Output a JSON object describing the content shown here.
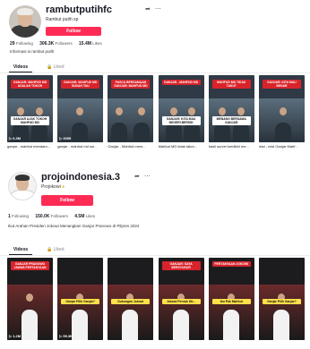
{
  "profiles": [
    {
      "username": "rambutputihfc",
      "nickname": "Rambut putih xp",
      "follow_label": "Follow",
      "stats": {
        "following": "29",
        "following_label": "Following",
        "followers": "306.3K",
        "followers_label": "Followers",
        "likes": "15.4M",
        "likes_label": "Likes"
      },
      "bio": "Informasi si rambut putih",
      "tabs": {
        "videos": "Videos",
        "liked": "Liked"
      },
      "videos": [
        {
          "caption_top": "GANJAR: MAHFUD MD ADALAH TOKOH",
          "caption_mid": "GANJAR AJAK TOKOH MAHFUD MD",
          "views": "6.3M",
          "title": "ganjar - mahfud mendam..."
        },
        {
          "caption_top": "GANJAR: MAHFUD MD SUDAH TAU",
          "caption_mid": "",
          "views": "3095",
          "title": "ganjar - mahfud md sul..."
        },
        {
          "caption_top": "PASCA BERSAMAAN GANJAR: MAHFUD MD",
          "caption_mid": "",
          "views": "",
          "title": "Ganjar - Mahfud mem..."
        },
        {
          "caption_top": "GANJAR - MAHFUD MD",
          "caption_mid": "GANJAR: KITA MAU NEGERI BERSIH",
          "views": "",
          "title": "Mahfud MD tidak takut..."
        },
        {
          "caption_top": "MAHFUD MD TIDAK TAKUT",
          "caption_mid": "MENANG BERSAMA GANJAR",
          "views": "",
          "title": "hasil survei kredibel me..."
        },
        {
          "caption_top": "GANJAR: KITA MAU BENAR",
          "caption_mid": "",
          "views": "",
          "title": "wisi - misi Ganjar Mahf..."
        }
      ]
    },
    {
      "username": "projoindonesia.3",
      "nickname": "Projokowi",
      "follow_label": "Follow",
      "stats": {
        "following": "1",
        "following_label": "Following",
        "followers": "150.0K",
        "followers_label": "Followers",
        "likes": "4.5M",
        "likes_label": "Likes"
      },
      "bio": "Ikut Arahan Presiden Jokowi Menangkan Ganjar Pranowo di Pilpres 2024",
      "tabs": {
        "videos": "Videos",
        "liked": "Liked"
      },
      "videos": [
        {
          "caption_top": "GANJAR PRANOWO JAWAB PERTANYAAN",
          "caption_mid": "",
          "views": "1.2M",
          "title": ""
        },
        {
          "caption_top": "",
          "caption_mid": "Ganjar Pilih Ganjar?",
          "views": "55.3K",
          "title": ""
        },
        {
          "caption_top": "",
          "caption_mid": "Dukungan Jokowi",
          "views": "",
          "title": ""
        },
        {
          "caption_top": "GANJAR: SAYA BERSYUKUR",
          "caption_mid": "Jokowi Pernah Dit...",
          "views": "",
          "title": ""
        },
        {
          "caption_top": "PERTANYAAN JOKOWI",
          "caption_mid": "Ibu Pak Mahfud",
          "views": "",
          "title": ""
        },
        {
          "caption_top": "",
          "caption_mid": "Ganjar Pilih Ganjar?",
          "views": "",
          "title": ""
        }
      ]
    }
  ]
}
